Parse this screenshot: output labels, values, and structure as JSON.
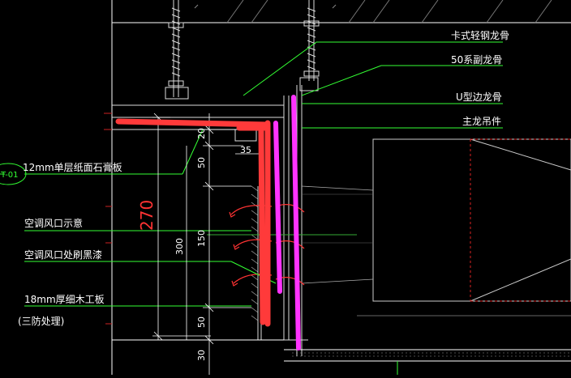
{
  "callouts": {
    "card_keel": "卡式轻钢龙骨",
    "sub_keel": "50系副龙骨",
    "u_keel": "U型边龙骨",
    "hanger": "主龙吊件",
    "gypsum": "12mm单层纸面石膏板",
    "vent_hint": "空调风口示意",
    "vent_paint": "空调风口处刷黑漆",
    "plywood": "18mm厚细木工板",
    "treatment": "(三防处理)"
  },
  "tag_label": "T-01",
  "dimensions": {
    "d20": "20",
    "d35": "35",
    "d50a": "50",
    "d300": "300",
    "d270": "270",
    "d150": "150",
    "d50b": "50",
    "d30": "30"
  },
  "colors": {
    "background": "#000000",
    "leader": "#33ff33",
    "markup_red": "#ff3a3a",
    "markup_magenta": "#ff33ff",
    "outline": "#ffffff",
    "duct": "#cccccc",
    "grid_red": "#cc2222"
  }
}
